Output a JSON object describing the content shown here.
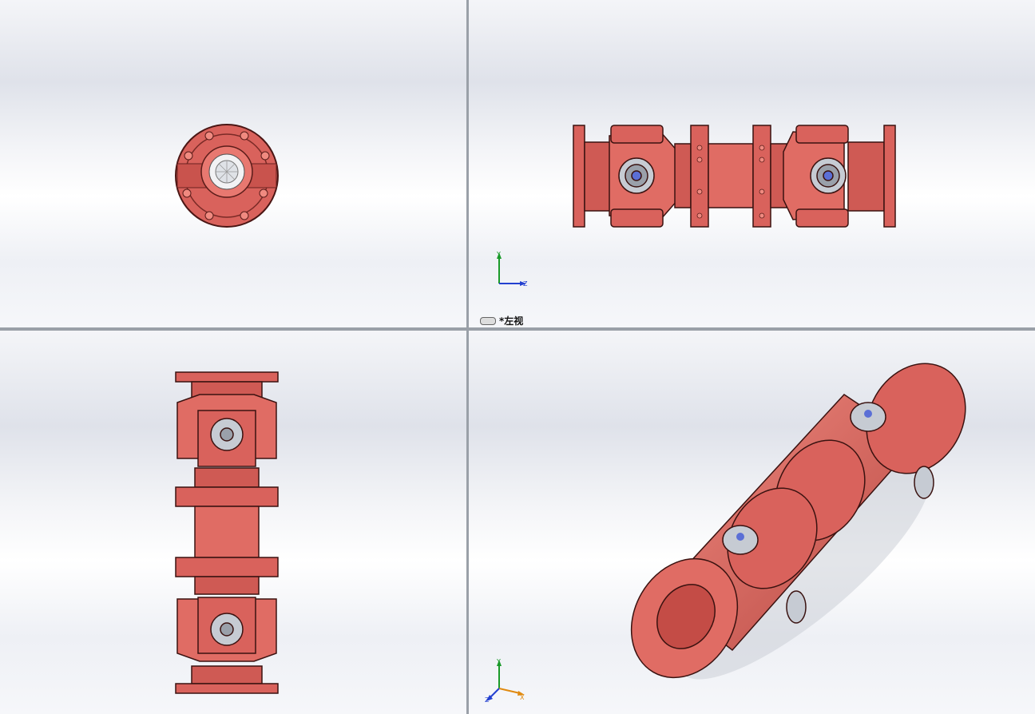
{
  "viewports": {
    "top_right": {
      "view_label": "*左视",
      "triad": {
        "axis_v": "Y",
        "axis_h": "Z"
      }
    },
    "bottom_right": {
      "triad": {
        "axis_v": "Y",
        "axis_h": "X",
        "axis_d": "Z"
      }
    }
  },
  "colors": {
    "part_red": "#d9625c",
    "part_dark": "#7a2a26",
    "part_light": "#f08a80",
    "bearing_cap": "#b9bec6",
    "bolt_blue": "#5b6fd6",
    "axis_y": "#1a9a2a",
    "axis_z": "#2340d0",
    "axis_x": "#e08a10"
  }
}
